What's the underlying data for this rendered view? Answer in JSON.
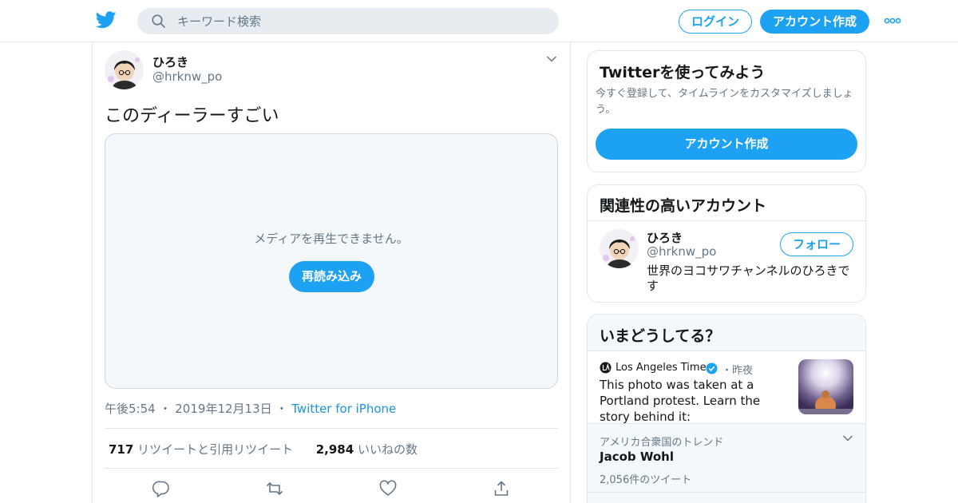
{
  "header": {
    "search_placeholder": "キーワード検索",
    "login_label": "ログイン",
    "signup_label": "アカウント作成"
  },
  "tweet": {
    "author_name": "ひろき",
    "author_handle": "@hrknw_po",
    "text": "このディーラーすごい",
    "media": {
      "error_message": "メディアを再生できません。",
      "reload_label": "再読み込み"
    },
    "time": "午後5:54",
    "date": "2019年12月13日",
    "source": "Twitter for iPhone",
    "retweet_count": "717",
    "retweet_label": "リツイートと引用リツイート",
    "like_count": "2,984",
    "like_label": "いいねの数"
  },
  "signup_card": {
    "title": "Twitterを使ってみよう",
    "description": "今すぐ登録して、タイムラインをカスタマイズしましょう。",
    "button_label": "アカウント作成"
  },
  "related_card": {
    "title": "関連性の高いアカウント",
    "account": {
      "name": "ひろき",
      "handle": "@hrknw_po",
      "follow_label": "フォロー",
      "bio": "世界のヨコサワチャンネルのひろきです"
    }
  },
  "happening_card": {
    "title": "いまどうしてる？",
    "news": {
      "source": "Los Angeles Times",
      "time": "昨夜",
      "text": "This photo was taken at a Portland protest. Learn the story behind it:"
    },
    "trend": {
      "location": "アメリカ合衆国のトレンド",
      "name": "Jacob Wohl",
      "count": "2,056件のツイート"
    }
  },
  "colors": {
    "accent": "#1da1f2",
    "link": "#1b95e0",
    "secondary_text": "#657786",
    "border": "#e1e8ed"
  },
  "icons": [
    "twitter-logo-icon",
    "search-icon",
    "more-icon",
    "chevron-down-icon",
    "reply-icon",
    "retweet-icon",
    "like-icon",
    "share-icon",
    "verified-icon"
  ]
}
